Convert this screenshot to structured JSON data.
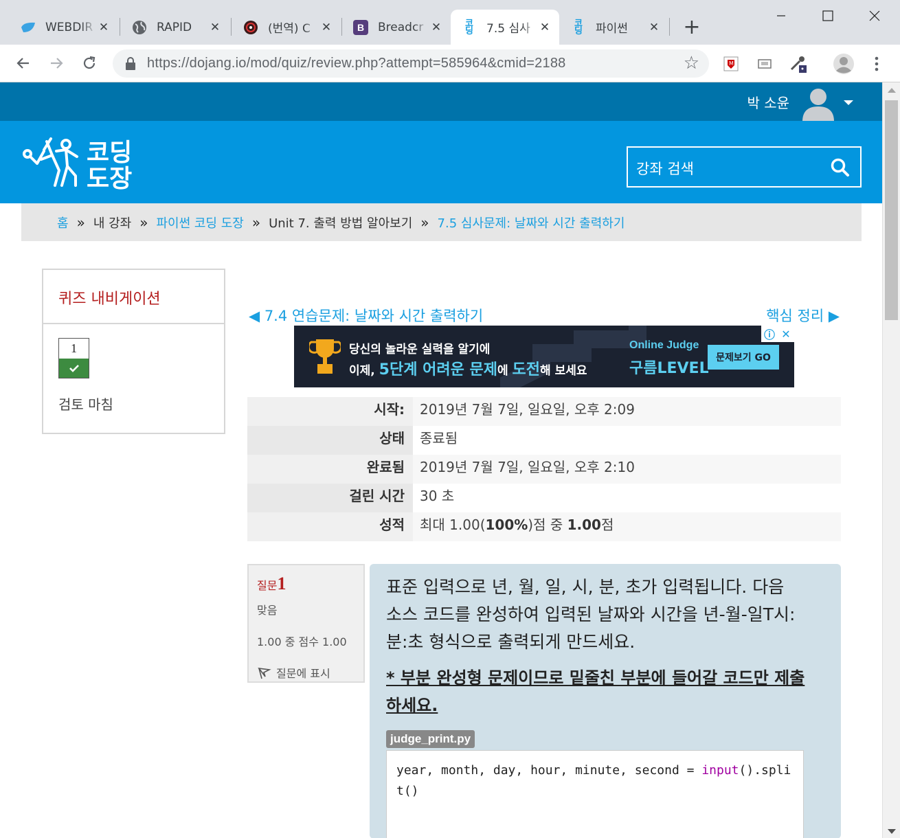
{
  "browser": {
    "tabs": [
      {
        "label": "WEBDIR",
        "icon": "leaf-icon",
        "close": "✕"
      },
      {
        "label": "RAPID",
        "icon": "globe-icon",
        "close": "✕"
      },
      {
        "label": "(번역) C",
        "icon": "dark-logo-icon",
        "close": "✕"
      },
      {
        "label": "Breadcr",
        "icon": "bootstrap-icon",
        "close": "✕"
      },
      {
        "label": "7.5 심사",
        "icon": "dojang-icon",
        "close": "✕",
        "active": true
      },
      {
        "label": "파이썬",
        "icon": "dojang-icon",
        "close": "✕"
      }
    ],
    "new_tab": "+",
    "url": "https://dojang.io/mod/quiz/review.php?attempt=585964&cmid=2188"
  },
  "header": {
    "username": "박 소윤",
    "logo_line1": "코딩",
    "logo_line2": "도장",
    "search_placeholder": "강좌 검색"
  },
  "breadcrumb": {
    "items": [
      {
        "label": "홈",
        "link": true
      },
      {
        "label": "내 강좌",
        "link": false
      },
      {
        "label": "파이썬 코딩 도장",
        "link": true
      },
      {
        "label": "Unit 7. 출력 방법 알아보기",
        "link": false
      },
      {
        "label": "7.5 심사문제: 날짜와 시간 출력하기",
        "link": true
      }
    ],
    "separator": "»"
  },
  "quiz_nav": {
    "title": "퀴즈 내비게이션",
    "question_number": "1",
    "finish_review": "검토 마침"
  },
  "nav_links": {
    "prev": "◀ 7.4 연습문제: 날짜와 시간 출력하기",
    "next": "핵심 정리 ▶"
  },
  "ad": {
    "line1": "당신의 놀라운 실력을 알기에",
    "line2_prefix": "이제, ",
    "line2_hl1": "5단계 어려운 문제",
    "line2_mid": "에 ",
    "line2_hl2": "도전",
    "line2_suffix": "해 보세요",
    "oj_title": "Online Judge",
    "oj_level": "구름LEVEL",
    "cta": "문제보기 GO",
    "info": "ⓘ",
    "close": "✕"
  },
  "summary": {
    "rows": [
      {
        "key": "시작:",
        "value": "2019년 7월 7일, 일요일, 오후 2:09"
      },
      {
        "key": "상태",
        "value": "종료됨"
      },
      {
        "key": "완료됨",
        "value": "2019년 7월 7일, 일요일, 오후 2:10"
      },
      {
        "key": "걸린 시간",
        "value": "30 초"
      }
    ],
    "grade_key": "성적",
    "grade_pre": "최대 1.00(",
    "grade_pct": "100%",
    "grade_mid": ")점 중 ",
    "grade_score": "1.00",
    "grade_post": "점"
  },
  "question": {
    "label": "질문",
    "number": "1",
    "state": "맞음",
    "grade": "1.00 중 점수 1.00",
    "flag": "질문에 표시",
    "text": "표준 입력으로 년, 월, 일, 시, 분, 초가 입력됩니다. 다음 소스 코드를 완성하여 입력된 날짜와 시간을 년-월-일T시:분:초 형식으로 출력되게 만드세요.",
    "note": " * 부분 완성형 문제이므로 밑줄친 부분에 들어갈 코드만 제출하세요.",
    "filename": "judge_print.py",
    "code_pre": "year, month, day, hour, minute, second = ",
    "code_kw": "input",
    "code_post": "().split()"
  }
}
